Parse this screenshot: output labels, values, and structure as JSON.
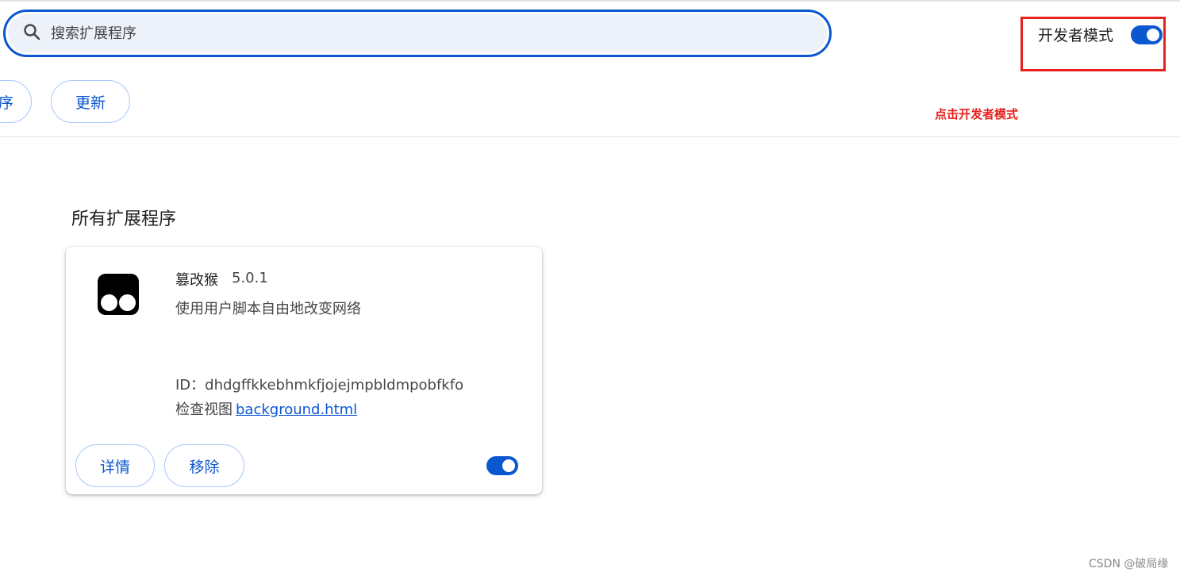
{
  "search": {
    "placeholder": "搜索扩展程序"
  },
  "header": {
    "dev_mode_label": "开发者模式",
    "dev_mode_enabled": true
  },
  "annotation": {
    "text": "点击开发者模式",
    "color": "#e8201c"
  },
  "toolbar": {
    "cut_button_label": "序",
    "update_button_label": "更新"
  },
  "section": {
    "title": "所有扩展程序"
  },
  "extension": {
    "name": "篡改猴",
    "version": "5.0.1",
    "description": "使用用户脚本自由地改变网络",
    "id_label": "ID：",
    "id_value": "dhdgffkkebhmkfjojejmpbldmpobfkfo",
    "inspect_label": "检查视图",
    "inspect_link": "background.html",
    "details_button": "详情",
    "remove_button": "移除",
    "enabled": true
  },
  "watermark": {
    "text": "CSDN @破局缘"
  },
  "colors": {
    "accent": "#0b57d0",
    "search_bg": "#edf2fa",
    "pill_border": "#a8c7fa",
    "annotation_red": "#e8201c"
  }
}
